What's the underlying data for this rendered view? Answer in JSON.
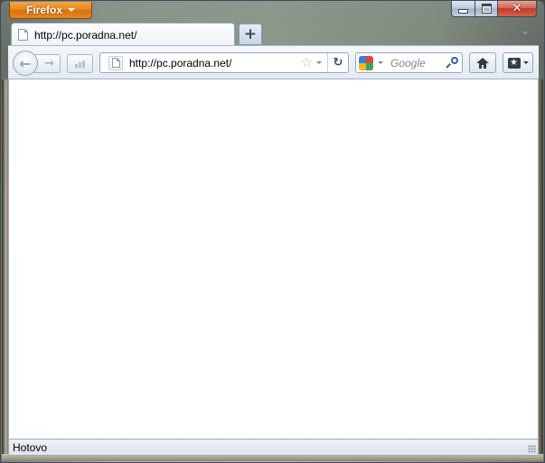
{
  "window": {
    "app_menu_label": "Firefox",
    "caption": {
      "close_glyph": "✕"
    }
  },
  "tabs": [
    {
      "title": "http://pc.poradna.net/"
    }
  ],
  "new_tab_glyph": "+",
  "toolbar": {
    "back_glyph": "←",
    "forward_glyph": "→",
    "url": "http://pc.poradna.net/",
    "bookmark_star_glyph": "☆",
    "reload_glyph": "↻",
    "search": {
      "engine": "Google",
      "placeholder": "Google"
    },
    "bookmarks_glyph": "★"
  },
  "status_bar": {
    "text": "Hotovo"
  },
  "icons": {
    "back": "back-arrow-icon",
    "forward": "forward-arrow-icon",
    "signal": "signal-bars-icon",
    "page": "page-icon",
    "star": "star-icon",
    "reload": "reload-icon",
    "search_engine": "google-icon",
    "search": "magnifier-icon",
    "home": "home-icon",
    "bookmarks": "bookmarks-icon"
  },
  "colors": {
    "firefox_button": "#e68a24",
    "close_button": "#c0392b",
    "toolbar": "#e3eaf3",
    "content_background": "#ffffff"
  }
}
